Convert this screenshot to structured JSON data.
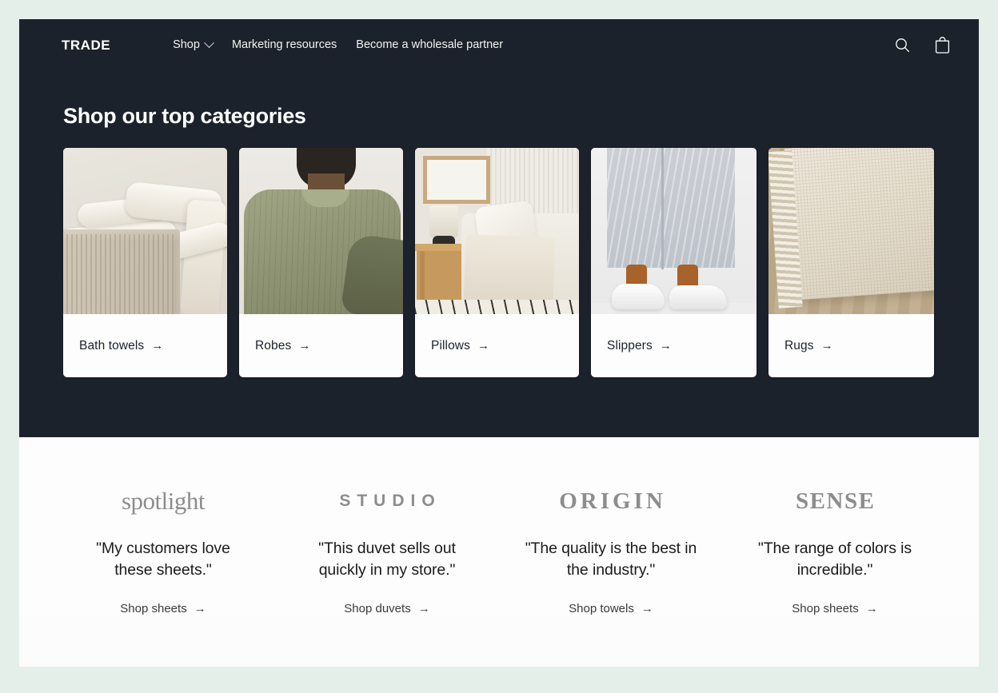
{
  "header": {
    "brand": "TRADE",
    "nav": [
      {
        "label": "Shop",
        "has_dropdown": true
      },
      {
        "label": "Marketing resources",
        "has_dropdown": false
      },
      {
        "label": "Become a wholesale partner",
        "has_dropdown": false
      }
    ],
    "actions": [
      {
        "icon": "search-icon"
      },
      {
        "icon": "shopping-bag-icon"
      }
    ]
  },
  "categories": {
    "title": "Shop our top categories",
    "background_color": "#1c222b",
    "cards": [
      {
        "label": "Bath towels",
        "arrow": "→",
        "image_alt": "Stack of cream bath towels on a rack"
      },
      {
        "label": "Robes",
        "arrow": "→",
        "image_alt": "Person wearing an olive green robe, back view"
      },
      {
        "label": "Pillows",
        "arrow": "→",
        "image_alt": "Living room sofa with cream pillow and throw"
      },
      {
        "label": "Slippers",
        "arrow": "→",
        "image_alt": "Feet in white slippers with light grey pajama pants"
      },
      {
        "label": "Rugs",
        "arrow": "→",
        "image_alt": "Corner of a cream woven rug with fringe on a wood floor"
      }
    ]
  },
  "testimonials": [
    {
      "logo": "spotlight",
      "logo_style": "spotlight",
      "quote": "\"My customers love these sheets.\"",
      "link_label": "Shop sheets",
      "arrow": "→"
    },
    {
      "logo": "STUDIO",
      "logo_style": "studio",
      "quote": "\"This duvet sells out quickly in my store.\"",
      "link_label": "Shop duvets",
      "arrow": "→"
    },
    {
      "logo": "ORIGIN",
      "logo_style": "origin",
      "quote": "\"The quality is the best in the industry.\"",
      "link_label": "Shop towels",
      "arrow": "→"
    },
    {
      "logo": "SENSE",
      "logo_style": "sense",
      "quote": "\"The range of colors is incredible.\"",
      "link_label": "Shop sheets",
      "arrow": "→"
    }
  ],
  "colors": {
    "page_background": "#e4efe9",
    "dark": "#1c222b",
    "card_background": "#fdfdfd",
    "logo_grey": "#8d8d8d"
  }
}
